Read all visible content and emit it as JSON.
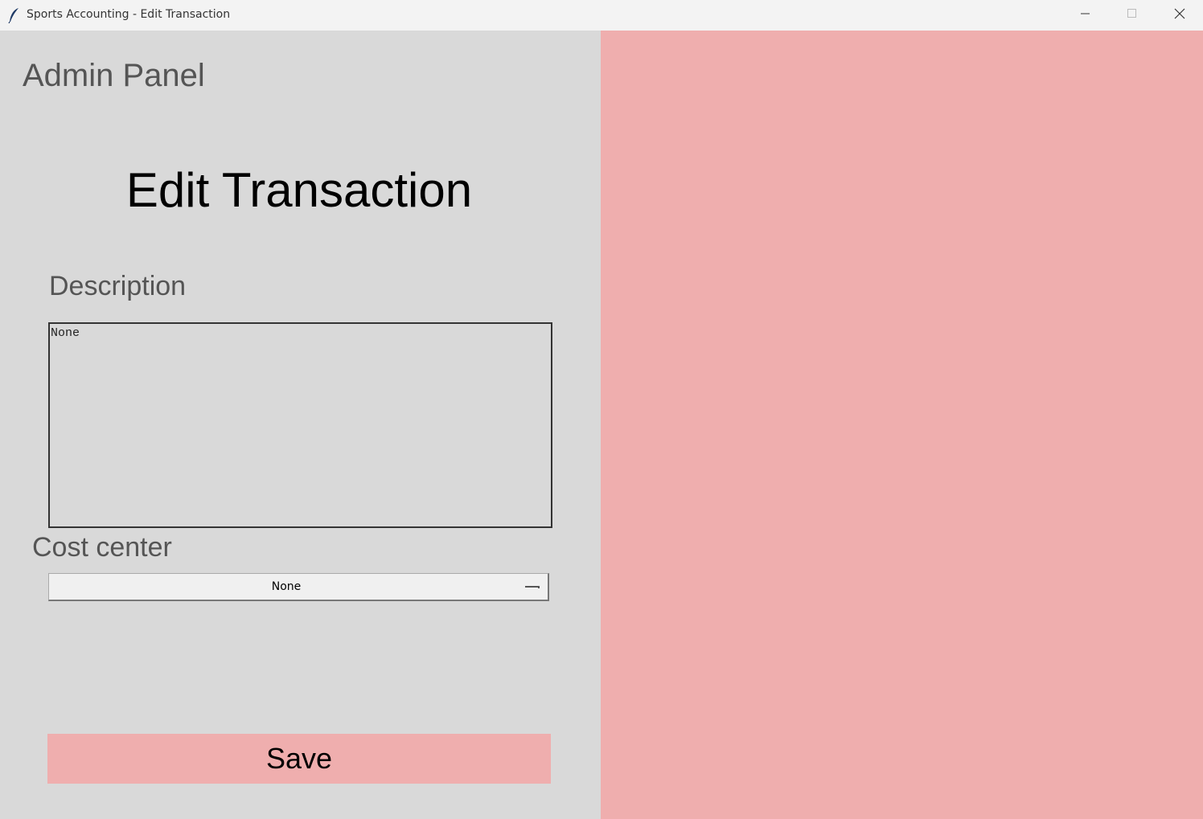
{
  "window": {
    "title": "Sports Accounting - Edit Transaction",
    "icon": "feather-icon",
    "controls": [
      "minimize-icon",
      "maximize-icon",
      "close-icon"
    ]
  },
  "header": {
    "admin_label": "Admin Panel",
    "page_title": "Edit Transaction"
  },
  "form": {
    "description_label": "Description",
    "description_value": "None",
    "cost_center_label": "Cost center",
    "cost_center_value": "None",
    "save_label": "Save"
  },
  "colors": {
    "accent": "#efaeae",
    "panel_background": "#d9d9d9"
  }
}
